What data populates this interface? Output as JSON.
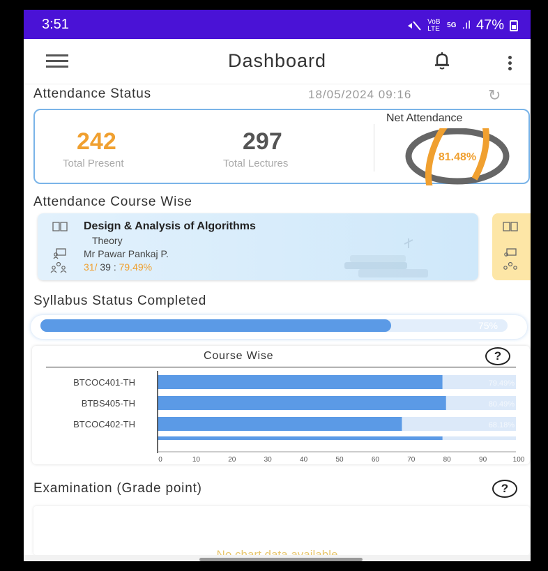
{
  "status_bar": {
    "time": "3:51",
    "mute_icon": "mute-icon",
    "volte": "VoB LTE",
    "net_type": "5G",
    "signal": ".ıl",
    "battery": "47%"
  },
  "header": {
    "title": "Dashboard",
    "menu_icon": "hamburger-menu-icon",
    "bell_icon": "bell-icon",
    "more_icon": "more-vertical-icon"
  },
  "attendance": {
    "title": "Attendance Status",
    "datetime": "18/05/2024 09:16",
    "refresh_icon": "refresh-icon",
    "present": "242",
    "present_label": "Total Present",
    "lectures": "297",
    "lectures_label": "Total Lectures",
    "net_label": "Net Attendance",
    "net_value": "81.48%",
    "net_fraction": 0.8148,
    "colors": {
      "accent": "#f0a030",
      "track": "#666666",
      "card_border": "#7ab4e8"
    }
  },
  "course_wise": {
    "title": "Attendance Course Wise",
    "card": {
      "name": "Design & Analysis of Algorithms",
      "type": "Theory",
      "teacher": "Mr Pawar Pankaj P.",
      "attended": "31/",
      "total": " 39 : ",
      "percent": "79.49%"
    }
  },
  "syllabus": {
    "title": "Syllabus Status Completed",
    "percent_label": "75%",
    "percent": 0.75,
    "chart": {
      "title": "Course Wise",
      "help": "?"
    }
  },
  "chart_data": {
    "type": "bar",
    "orientation": "horizontal",
    "title": "Course Wise",
    "categories": [
      "BTCOC401-TH",
      "BTBS405-TH",
      "BTCOC402-TH",
      ""
    ],
    "values": [
      79.49,
      80.49,
      68.18,
      79.5
    ],
    "value_labels": [
      "79.49%",
      "80.49%",
      "68.18%",
      ""
    ],
    "xlim": [
      0,
      100
    ],
    "xticks": [
      "0",
      "10",
      "20",
      "30",
      "40",
      "50",
      "60",
      "70",
      "80",
      "90",
      "100"
    ],
    "colors": {
      "bar": "#5b9ae6",
      "track": "#dce9f9"
    }
  },
  "exam": {
    "title": "Examination (Grade point)",
    "help": "?",
    "no_data": "No chart data available"
  }
}
